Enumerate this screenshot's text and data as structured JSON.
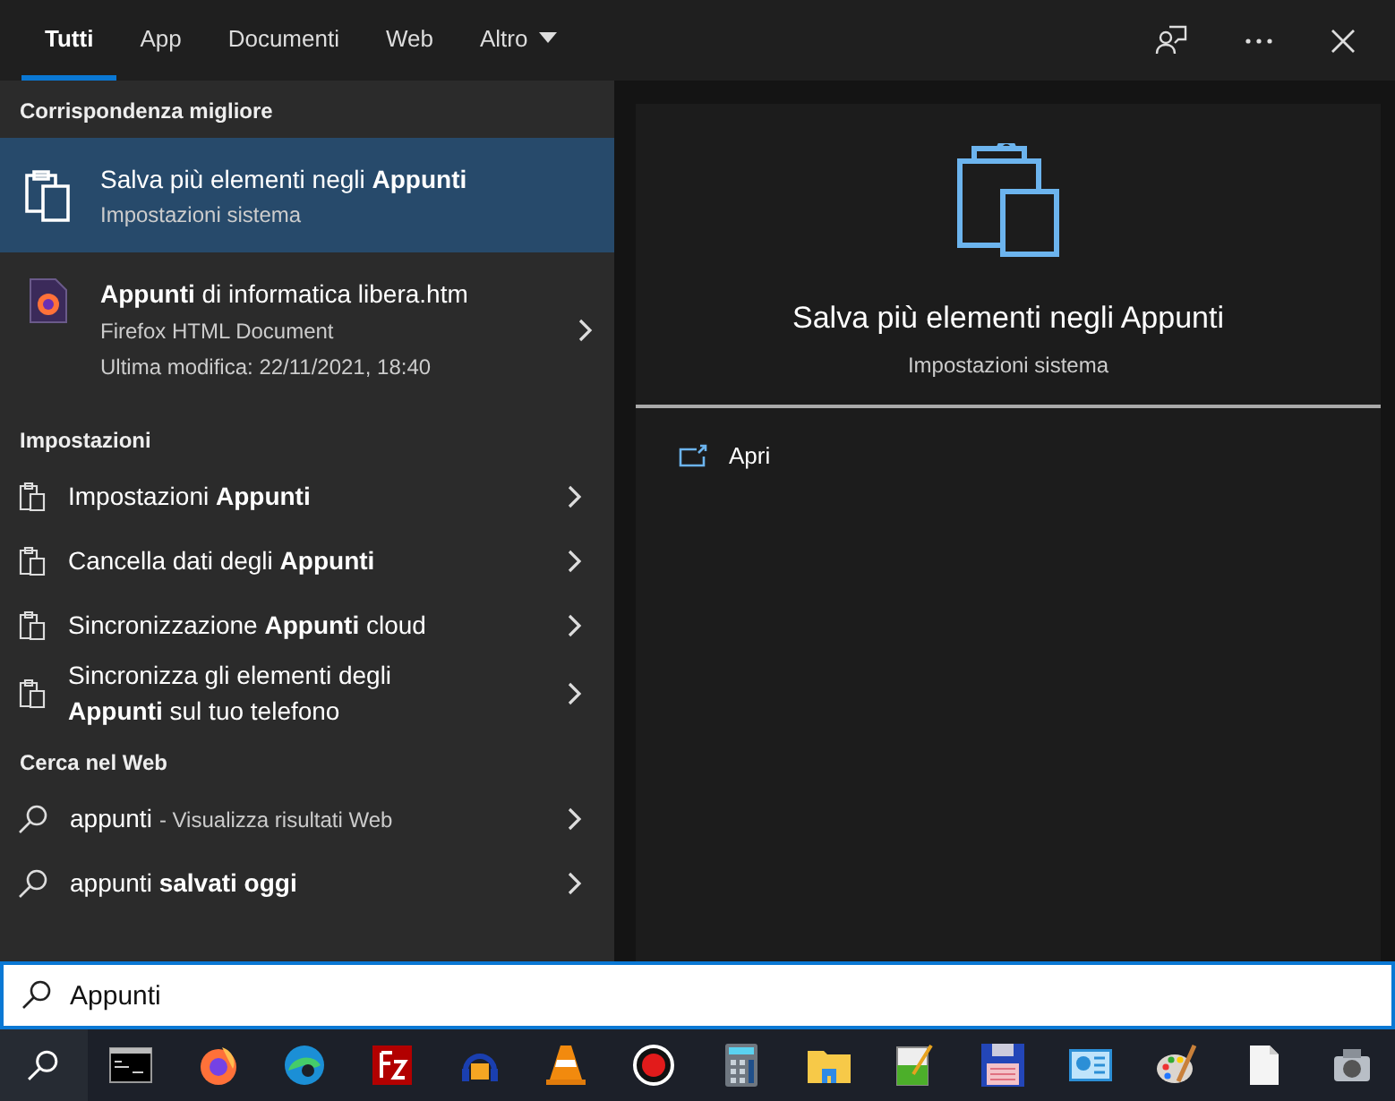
{
  "tabs": [
    {
      "label": "Tutti",
      "selected": true
    },
    {
      "label": "App",
      "selected": false
    },
    {
      "label": "Documenti",
      "selected": false
    },
    {
      "label": "Web",
      "selected": false
    },
    {
      "label": "Altro",
      "selected": false,
      "dropdown": true
    }
  ],
  "best_match": {
    "heading": "Corrispondenza migliore",
    "title": "Salva più elementi negli **Appunti**",
    "subtitle": "Impostazioni sistema",
    "selected": true
  },
  "document": {
    "title": "**Appunti** di informatica libera.htm",
    "type": "Firefox HTML Document",
    "modified": "Ultima modifica: 22/11/2021, 18:40"
  },
  "sections": [
    {
      "heading": "Impostazioni",
      "items": [
        {
          "kind": "setting",
          "text": "Impostazioni **Appunti**"
        },
        {
          "kind": "setting",
          "text": "Cancella dati degli **Appunti**"
        },
        {
          "kind": "setting",
          "text": "Sincronizzazione **Appunti** cloud"
        },
        {
          "kind": "setting",
          "text": "Sincronizza gli elementi degli\n**Appunti** sul tuo telefono"
        }
      ]
    },
    {
      "heading": "Cerca nel Web",
      "items": [
        {
          "kind": "web",
          "text": "appunti",
          "hint": "- Visualizza risultati Web"
        },
        {
          "kind": "web",
          "text": "appunti **salvati oggi**"
        }
      ]
    }
  ],
  "preview": {
    "title": "Salva più elementi negli Appunti",
    "subtitle": "Impostazioni sistema",
    "actions": [
      "Apri"
    ]
  },
  "search": {
    "value": "Appunti"
  },
  "taskbar": [
    {
      "kind": "search"
    },
    {
      "kind": "terminal"
    },
    {
      "kind": "firefox"
    },
    {
      "kind": "edge"
    },
    {
      "kind": "filezilla"
    },
    {
      "kind": "headphones"
    },
    {
      "kind": "cone"
    },
    {
      "kind": "record"
    },
    {
      "kind": "calculator"
    },
    {
      "kind": "folder"
    },
    {
      "kind": "notepad"
    },
    {
      "kind": "floppy"
    },
    {
      "kind": "panel"
    },
    {
      "kind": "palette"
    },
    {
      "kind": "page"
    },
    {
      "kind": "camera"
    }
  ]
}
